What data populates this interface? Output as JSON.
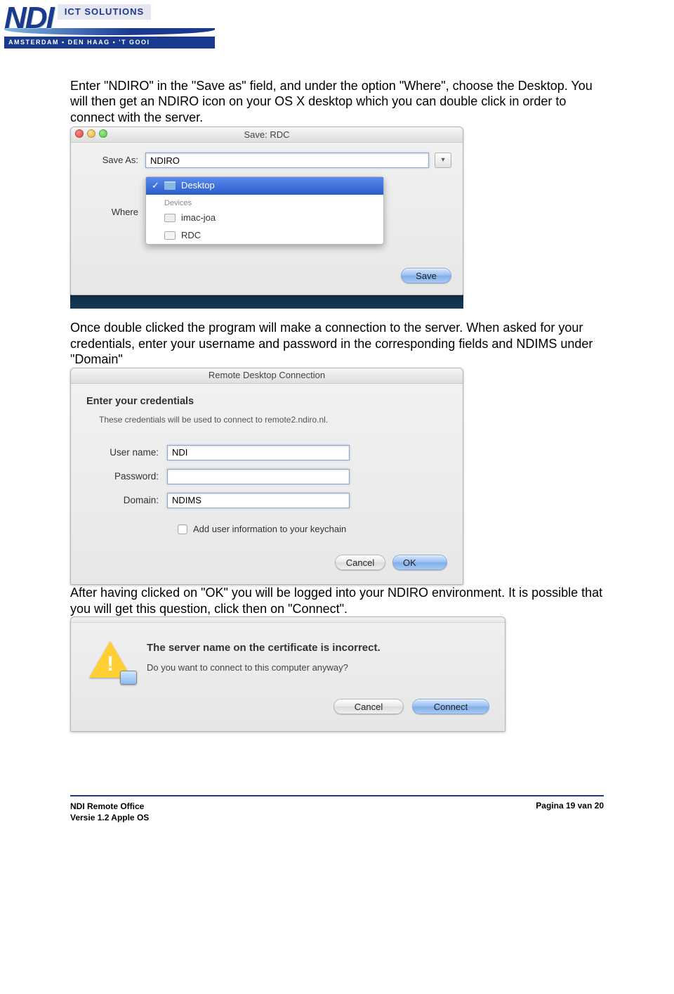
{
  "logo": {
    "brand": "NDI",
    "tagline": "ICT SOLUTIONS",
    "locations": "AMSTERDAM  •  DEN HAAG  •  'T GOOI"
  },
  "para1": "Enter \"NDIRO\" in the \"Save as\" field, and under the option \"Where\", choose the Desktop. You will then get an NDIRO icon on your OS X desktop which you can double click in order to connect with the server.",
  "save_dialog": {
    "title": "Save: RDC",
    "save_as_label": "Save As:",
    "save_as_value": "NDIRO",
    "where_label": "Where",
    "where_selected": "Desktop",
    "devices_label": "Devices",
    "device1": "imac-joa",
    "device2": "RDC",
    "save_btn": "Save"
  },
  "para2": "Once double clicked the program will make a connection to the server. When asked for your credentials, enter your username and password in the corresponding fields and NDIMS under \"Domain\"",
  "cred_dialog": {
    "title": "Remote Desktop Connection",
    "heading": "Enter your credentials",
    "subtext": "These credentials will be used to connect to remote2.ndiro.nl.",
    "user_label": "User name:",
    "user_value": "NDI",
    "pass_label": "Password:",
    "pass_value": "",
    "domain_label": "Domain:",
    "domain_value": "NDIMS",
    "keychain": "Add user information to your keychain",
    "cancel": "Cancel",
    "ok": "OK"
  },
  "para3": "After having clicked on \"OK\" you will be logged into your NDIRO environment. It is possible that you will get this question, click then on \"Connect\".",
  "cert_dialog": {
    "heading": "The server name on the certificate is incorrect.",
    "subtext": "Do you want to connect to this computer anyway?",
    "cancel": "Cancel",
    "connect": "Connect"
  },
  "footer": {
    "line1": "NDI Remote Office",
    "line2": "Versie 1.2 Apple OS",
    "page": "Pagina 19 van 20"
  }
}
